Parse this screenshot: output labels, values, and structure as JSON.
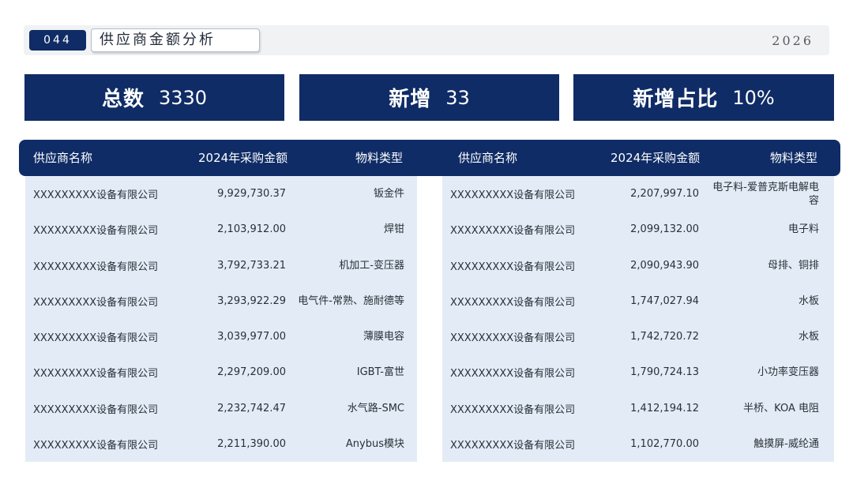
{
  "header": {
    "page_number": "044",
    "title": "供应商金额分析",
    "year": "2026"
  },
  "stats": [
    {
      "label": "总数",
      "value": "3330"
    },
    {
      "label": "新增",
      "value": "33"
    },
    {
      "label": "新增占比",
      "value": "10%"
    }
  ],
  "table": {
    "columns": [
      "供应商名称",
      "2024年采购金额",
      "物料类型"
    ],
    "left_rows": [
      {
        "name": "XXXXXXXXX设备有限公司",
        "amount": "9,929,730.37",
        "type": "钣金件"
      },
      {
        "name": "XXXXXXXXX设备有限公司",
        "amount": "2,103,912.00",
        "type": "焊钳"
      },
      {
        "name": "XXXXXXXXX设备有限公司",
        "amount": "3,792,733.21",
        "type": "机加工-变压器"
      },
      {
        "name": "XXXXXXXXX设备有限公司",
        "amount": "3,293,922.29",
        "type": "电气件-常熟、施耐德等"
      },
      {
        "name": "XXXXXXXXX设备有限公司",
        "amount": "3,039,977.00",
        "type": "薄膜电容"
      },
      {
        "name": "XXXXXXXXX设备有限公司",
        "amount": "2,297,209.00",
        "type": "IGBT-富世"
      },
      {
        "name": "XXXXXXXXX设备有限公司",
        "amount": "2,232,742.47",
        "type": "水气路-SMC"
      },
      {
        "name": "XXXXXXXXX设备有限公司",
        "amount": "2,211,390.00",
        "type": "Anybus模块"
      }
    ],
    "right_rows": [
      {
        "name": "XXXXXXXXX设备有限公司",
        "amount": "2,207,997.10",
        "type": "电子料-爱普克斯电解电容"
      },
      {
        "name": "XXXXXXXXX设备有限公司",
        "amount": "2,099,132.00",
        "type": "电子料"
      },
      {
        "name": "XXXXXXXXX设备有限公司",
        "amount": "2,090,943.90",
        "type": "母排、铜排"
      },
      {
        "name": "XXXXXXXXX设备有限公司",
        "amount": "1,747,027.94",
        "type": "水板"
      },
      {
        "name": "XXXXXXXXX设备有限公司",
        "amount": "1,742,720.72",
        "type": "水板"
      },
      {
        "name": "XXXXXXXXX设备有限公司",
        "amount": "1,790,724.13",
        "type": "小功率变压器"
      },
      {
        "name": "XXXXXXXXX设备有限公司",
        "amount": "1,412,194.12",
        "type": "半桥、KOA 电阻"
      },
      {
        "name": "XXXXXXXXX设备有限公司",
        "amount": "1,102,770.00",
        "type": "触摸屏-威纶通"
      }
    ]
  },
  "colors": {
    "navy": "#0f2c66",
    "panel": "#e3ecf6",
    "title_bar": "#f1f2f4"
  }
}
